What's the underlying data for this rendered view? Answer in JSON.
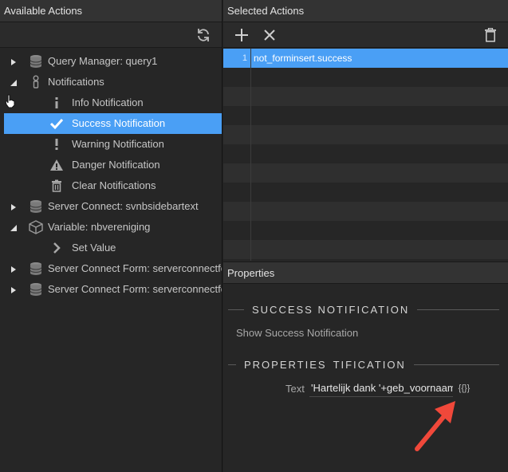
{
  "left_panel": {
    "title": "Available Actions",
    "toolbar": {
      "refresh_icon": "refresh-icon"
    },
    "tree": [
      {
        "label": "Query Manager: query1",
        "icon": "database-icon",
        "caret": "right",
        "level": 0
      },
      {
        "label": "Notifications",
        "icon": "notification-icon",
        "caret": "down",
        "level": 0
      },
      {
        "label": "Info Notification",
        "icon": "info-icon",
        "level": 1
      },
      {
        "label": "Success Notification",
        "icon": "check-icon",
        "level": 1,
        "selected": true
      },
      {
        "label": "Warning Notification",
        "icon": "exclamation-icon",
        "level": 1
      },
      {
        "label": "Danger Notification",
        "icon": "warning-triangle-icon",
        "level": 1
      },
      {
        "label": "Clear Notifications",
        "icon": "trash-icon",
        "level": 1
      },
      {
        "label": "Server Connect: svnbsidebartext",
        "icon": "database-icon",
        "caret": "right",
        "level": 0
      },
      {
        "label": "Variable: nbvereniging",
        "icon": "cube-icon",
        "caret": "down",
        "level": 0
      },
      {
        "label": "Set Value",
        "icon": "chevron-right-icon",
        "level": 1
      },
      {
        "label": "Server Connect Form: serverconnectform",
        "icon": "database-icon",
        "caret": "right",
        "level": 0
      },
      {
        "label": "Server Connect Form: serverconnectform",
        "icon": "database-icon",
        "caret": "right",
        "level": 0
      }
    ]
  },
  "right_panel": {
    "title": "Selected Actions",
    "toolbar": {
      "add_icon": "plus-icon",
      "remove_icon": "close-icon",
      "delete_icon": "trash-icon"
    },
    "actions": [
      {
        "num": "1",
        "text": "not_forminsert.success"
      }
    ]
  },
  "properties": {
    "title": "Properties",
    "section1_title": "Success Notification",
    "description": "Show Success Notification",
    "section2_title_a": "Properties",
    "section2_title_b": "tification",
    "text_label": "Text",
    "text_value": "'Hartelijk dank '+geb_voornaam",
    "expr_button_label": "{{}}"
  },
  "colors": {
    "accent": "#4a9ff5",
    "arrow": "#f0483a"
  }
}
